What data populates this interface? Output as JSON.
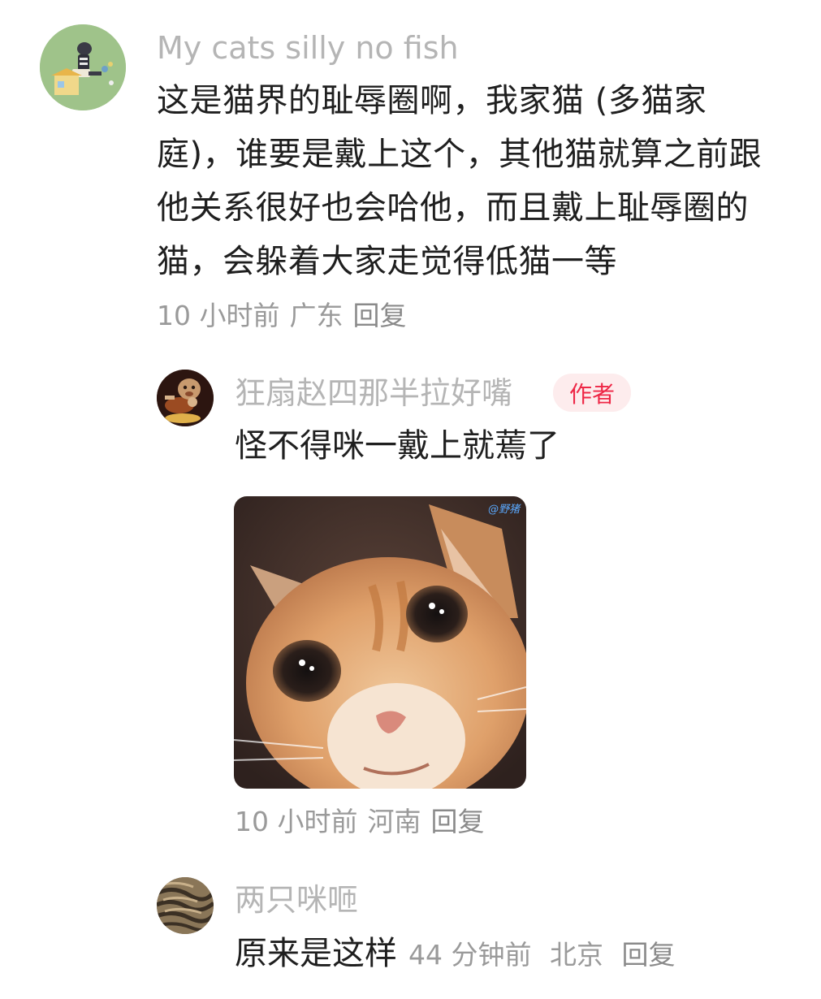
{
  "comment": {
    "username": "My cats silly no fish",
    "avatar_icon": "cartoon-avatar",
    "text_lines": [
      "这是猫界的耻辱圈啊，我家猫 (多猫家",
      "庭)，谁要是戴上这个，其他猫就算之前跟",
      "他关系很好也会哈他，而且戴上耻辱圈的",
      "猫，会躲着大家走觉得低猫一等"
    ],
    "time": "10 小时前",
    "location": "广东",
    "reply_label": "回复"
  },
  "replies": [
    {
      "username": "狂扇赵四那半拉好嘴",
      "avatar_icon": "dog-avatar",
      "badge": "作者",
      "text": "怪不得咪一戴上就蔫了",
      "image_icon": "crying-cat-image",
      "image_watermark": "@野猪",
      "time": "10 小时前",
      "location": "河南",
      "reply_label": "回复"
    },
    {
      "username": "两只咪咂",
      "avatar_icon": "tabby-cat-avatar",
      "text": "原来是这样",
      "time": "44 分钟前",
      "location": "北京",
      "reply_label": "回复"
    }
  ],
  "colors": {
    "username": "#b5b5b5",
    "text": "#1f1f1f",
    "meta": "#9a9a9a",
    "badge_bg": "#fdeced",
    "badge_text": "#ee2746"
  }
}
